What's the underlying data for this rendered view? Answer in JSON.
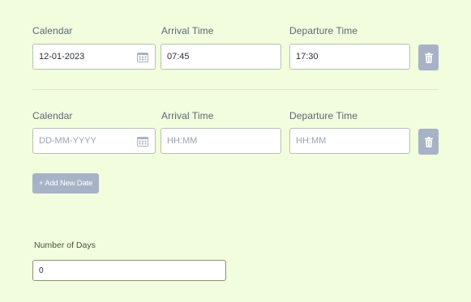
{
  "rows": [
    {
      "calendar_label": "Calendar",
      "arrival_label": "Arrival Time",
      "departure_label": "Departure Time",
      "calendar_value": "12-01-2023",
      "arrival_value": "07:45",
      "departure_value": "17:30"
    },
    {
      "calendar_label": "Calendar",
      "arrival_label": "Arrival Time",
      "departure_label": "Departure Time",
      "calendar_placeholder": "DD-MM-YYYY",
      "arrival_placeholder": "HH:MM",
      "departure_placeholder": "HH:MM"
    }
  ],
  "add_button_label": "+ Add New Date",
  "days": {
    "label": "Number of Days",
    "value": "0"
  },
  "colors": {
    "background": "#f1fddc",
    "button": "#a8b2c6"
  }
}
